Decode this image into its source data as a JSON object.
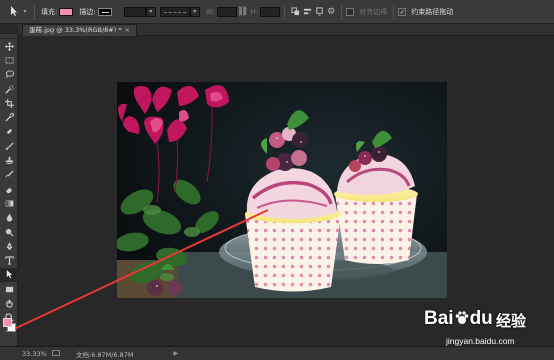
{
  "options_bar": {
    "tool_preset_icon": "path-selection-icon",
    "fill_label": "填充:",
    "fill_color": "#f48fb1",
    "stroke_label": "描边:",
    "stroke_color": "#000000",
    "width_label": "W:",
    "height_label": "H:",
    "align_edges_label": "对齐边缘",
    "constrain_paths_label": "约束路径拖动"
  },
  "document_tab": {
    "title": "蛋糕.jpg @ 33.3%(RGB/8#) *",
    "close_glyph": "×"
  },
  "toolbox": {
    "tools": [
      "move-icon",
      "marquee-icon",
      "lasso-icon",
      "quick-select-icon",
      "crop-icon",
      "eyedropper-icon",
      "healing-brush-icon",
      "brush-icon",
      "clone-stamp-icon",
      "history-brush-icon",
      "eraser-icon",
      "gradient-icon",
      "blur-icon",
      "dodge-icon",
      "pen-icon",
      "type-icon",
      "path-selection-icon",
      "rectangle-shape-icon",
      "hand-icon",
      "zoom-icon"
    ],
    "foreground_color": "#f48fb1",
    "background_color": "#ffffff"
  },
  "status_bar": {
    "zoom": "33.33%",
    "doc_info": "文档:6.87M/6.87M",
    "more_glyph": "▶"
  },
  "annotation": {
    "arrow_color": "#e53935"
  },
  "watermark": {
    "logo_text": "Bai",
    "logo_suffix": "du",
    "cn_text": "经验",
    "url": "jingyan.baidu.com"
  }
}
